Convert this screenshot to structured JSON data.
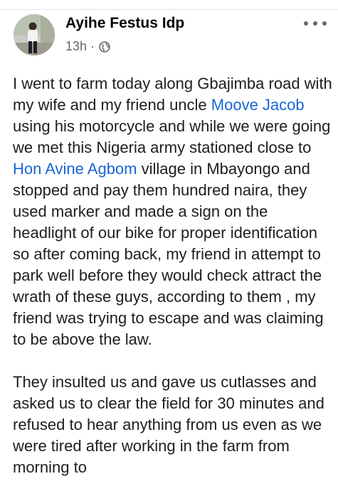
{
  "post": {
    "author": "Ayihe Festus Idp",
    "timestamp": "13h",
    "separator": "·",
    "privacy_icon": "globe-icon",
    "more_icon": "more-options-icon",
    "mention_color": "#1a66d6",
    "paragraph1": {
      "seg1": "I went to farm today along Gbajimba road with my wife and my friend uncle ",
      "mention1": "Moove Jacob",
      "seg2": " using his motorcycle and while we were going we met this Nigeria army stationed close to ",
      "mention2": "Hon Avine Agbom",
      "seg3": " village in Mbayongo and stopped and pay them hundred naira, they used marker and made a sign on the headlight of our bike for proper identification so after coming back, my friend in attempt to park well before they would check attract the wrath of these guys, according to them , my friend was trying to escape and was claiming to be above the law."
    },
    "paragraph2": "They insulted us and gave us cutlasses and asked us to clear the field for 30 minutes and refused to hear anything from us even as we were tired after working in the farm from morning to"
  }
}
